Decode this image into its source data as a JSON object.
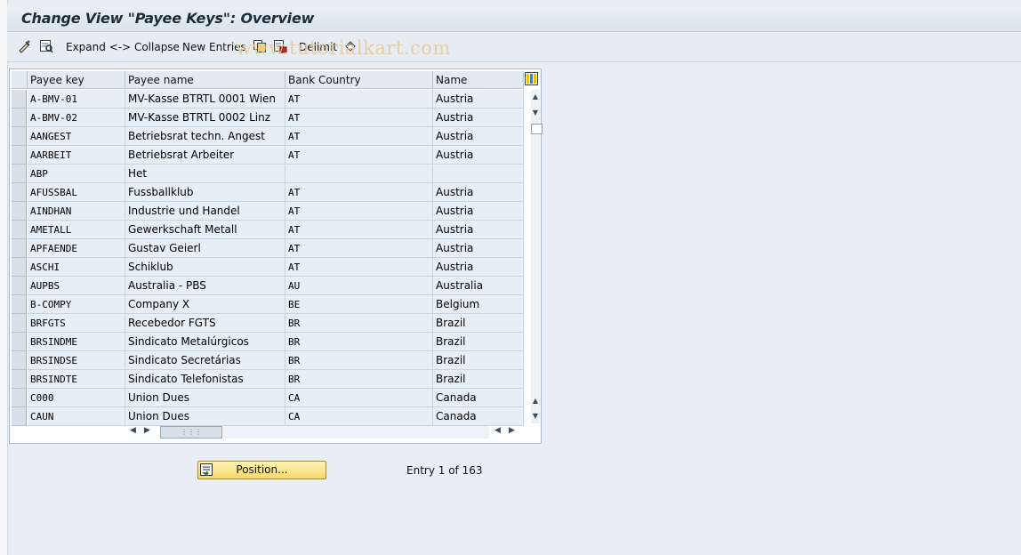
{
  "window": {
    "title": "Change View \"Payee Keys\": Overview"
  },
  "toolbar": {
    "expand_collapse": "Expand <-> Collapse",
    "new_entries": "New Entries",
    "delimit": "Delimit",
    "watermark": "www.tutorialkart.com"
  },
  "table": {
    "headers": [
      "Payee key",
      "Payee name",
      "Bank Country",
      "Name"
    ],
    "rows": [
      [
        "A-BMV-01",
        "MV-Kasse  BTRTL 0001 Wien",
        "AT",
        "Austria"
      ],
      [
        "A-BMV-02",
        "MV-Kasse  BTRTL 0002 Linz",
        "AT",
        "Austria"
      ],
      [
        "AANGEST",
        "Betriebsrat techn. Angest",
        "AT",
        "Austria"
      ],
      [
        "AARBEIT",
        "Betriebsrat Arbeiter",
        "AT",
        "Austria"
      ],
      [
        "ABP",
        "Het",
        "",
        ""
      ],
      [
        "AFUSSBAL",
        "Fussballklub",
        "AT",
        "Austria"
      ],
      [
        "AINDHAN",
        "Industrie und Handel",
        "AT",
        "Austria"
      ],
      [
        "AMETALL",
        "Gewerkschaft Metall",
        "AT",
        "Austria"
      ],
      [
        "APFAENDE",
        "Gustav Geierl",
        "AT",
        "Austria"
      ],
      [
        "ASCHI",
        "Schiklub",
        "AT",
        "Austria"
      ],
      [
        "AUPBS",
        "Australia - PBS",
        "AU",
        "Australia"
      ],
      [
        "B-COMPY",
        "Company X",
        "BE",
        "Belgium"
      ],
      [
        "BRFGTS",
        "Recebedor FGTS",
        "BR",
        "Brazil"
      ],
      [
        "BRSINDME",
        "Sindicato Metalúrgicos",
        "BR",
        "Brazil"
      ],
      [
        "BRSINDSE",
        "Sindicato Secretárias",
        "BR",
        "Brazil"
      ],
      [
        "BRSINDTE",
        "Sindicato Telefonistas",
        "BR",
        "Brazil"
      ],
      [
        "C000",
        "Union Dues",
        "CA",
        "Canada"
      ],
      [
        "CAUN",
        "Union Dues",
        "CA",
        "Canada"
      ]
    ]
  },
  "footer": {
    "position_button": "Position...",
    "entry_info": "Entry 1 of 163"
  },
  "colors": {
    "row_bg": "#e7eff6",
    "button_yellow": "#f6d86a",
    "title_text": "#1b2c3a"
  }
}
